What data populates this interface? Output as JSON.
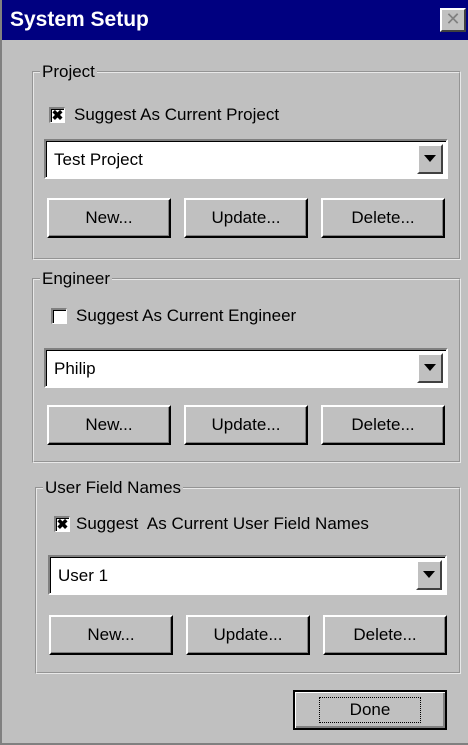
{
  "window": {
    "title": "System Setup",
    "close_glyph": "✕"
  },
  "groups": [
    {
      "legend": "Project",
      "checkbox": {
        "label": "Suggest As Current Project",
        "checked": true
      },
      "combo": {
        "value": "Test Project"
      },
      "buttons": [
        "New...",
        "Update...",
        "Delete..."
      ]
    },
    {
      "legend": "Engineer",
      "checkbox": {
        "label": "Suggest As Current Engineer",
        "checked": false
      },
      "combo": {
        "value": "Philip"
      },
      "buttons": [
        "New...",
        "Update...",
        "Delete..."
      ]
    },
    {
      "legend": "User Field Names",
      "checkbox": {
        "label": "Suggest  As Current User Field Names",
        "checked": true
      },
      "combo": {
        "value": "User 1"
      },
      "buttons": [
        "New...",
        "Update...",
        "Delete..."
      ]
    }
  ],
  "done_button": {
    "label": "Done"
  },
  "check_mark": "✖",
  "colors": {
    "titlebar": "#000080",
    "face": "#c0c0c0",
    "field": "#ffffff"
  }
}
